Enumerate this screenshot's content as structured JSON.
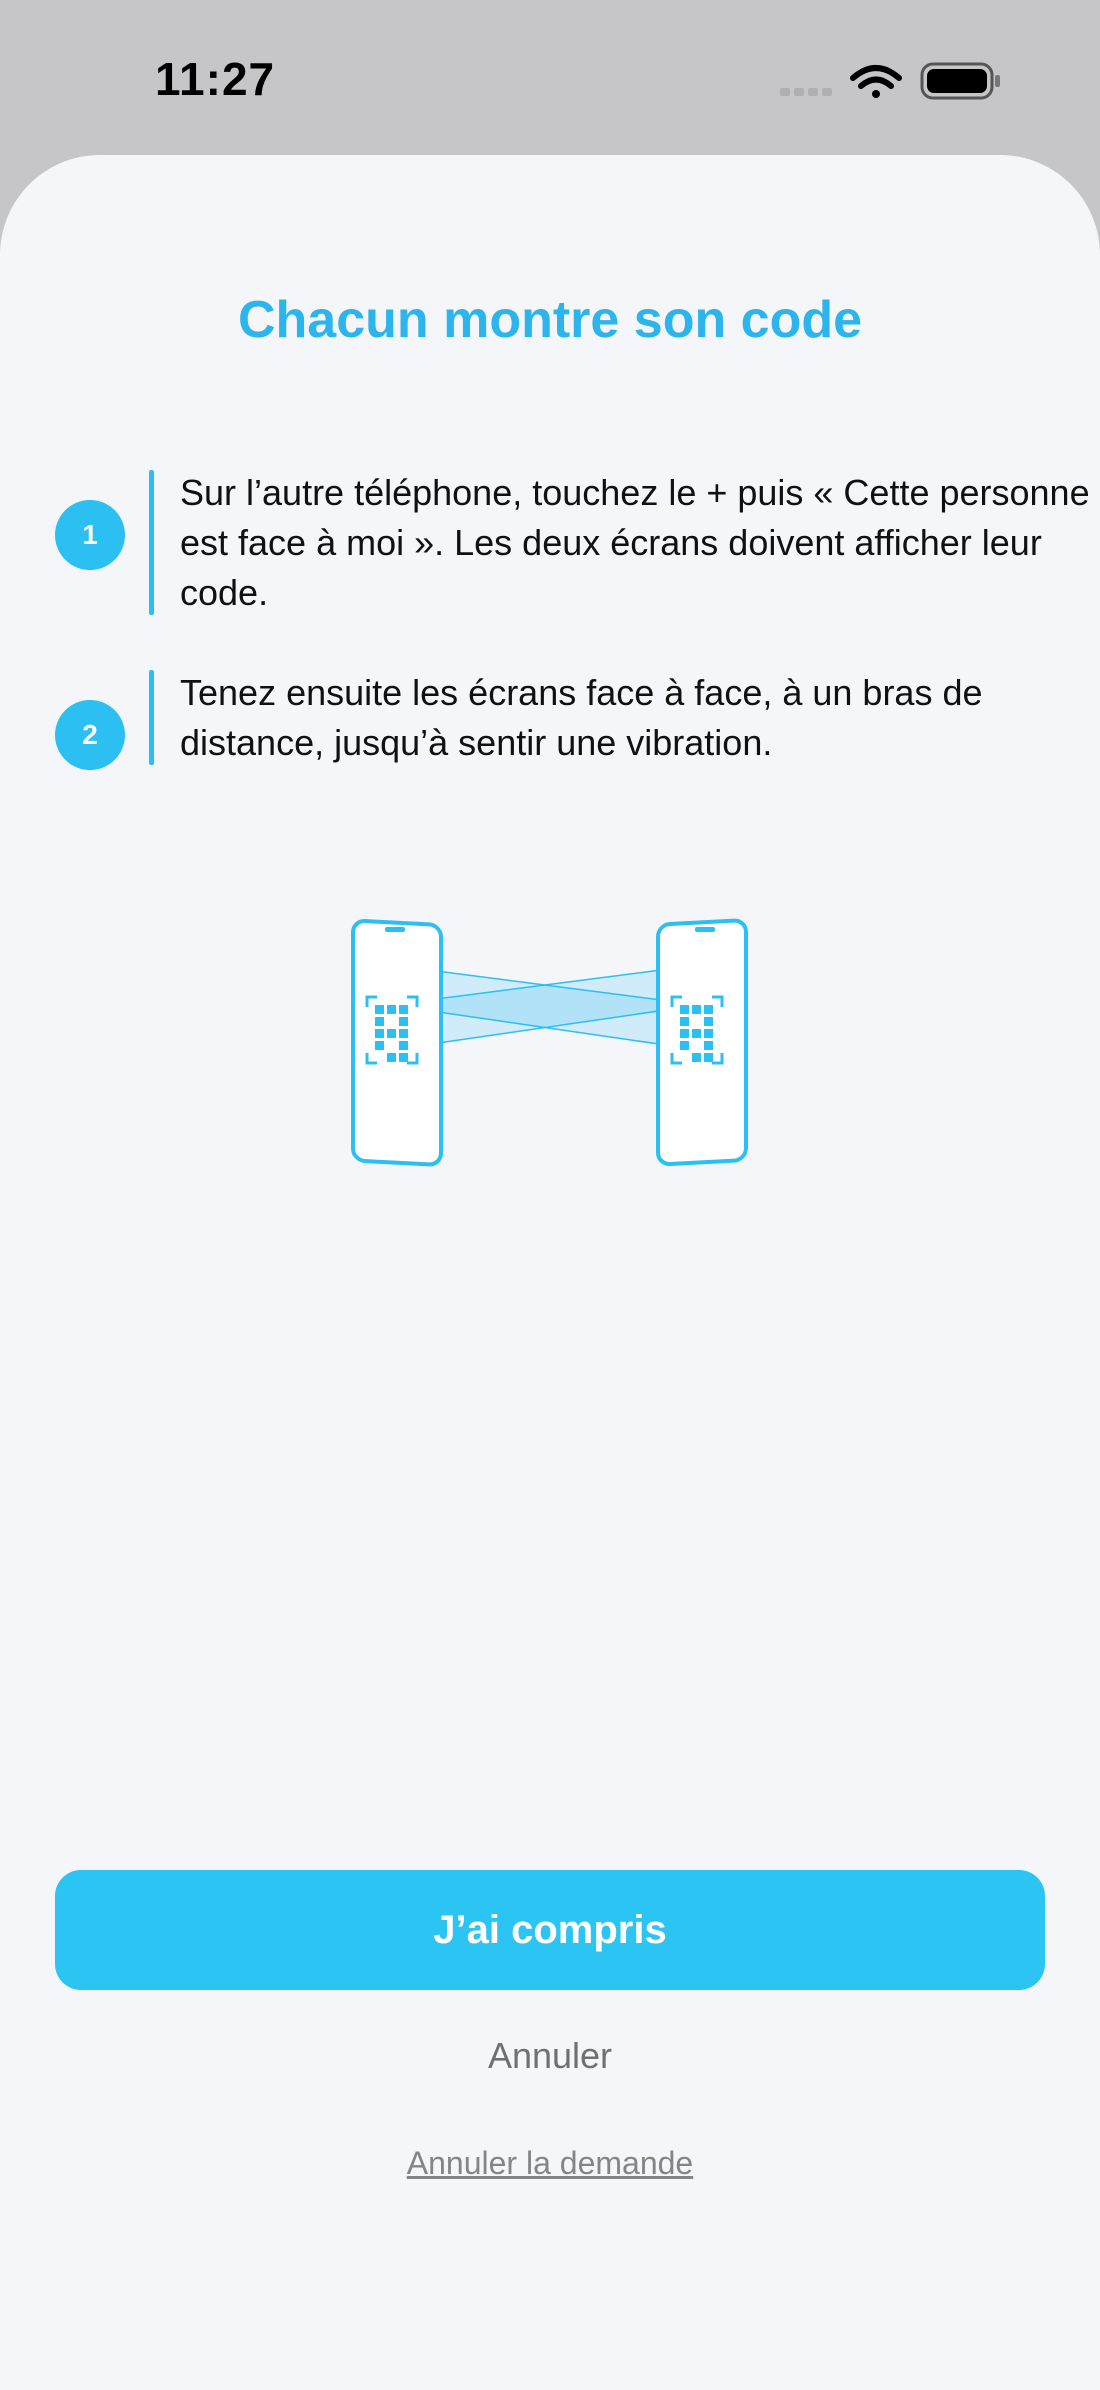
{
  "status_bar": {
    "time": "11:27",
    "icons": [
      "cellular-icon",
      "wifi-icon",
      "battery-icon"
    ]
  },
  "sheet": {
    "title": "Chacun montre son code",
    "steps": [
      {
        "number": "1",
        "text": "Sur l’autre téléphone, touchez le + puis « Cette personne est face à moi ». Les deux écrans doivent afficher leur code."
      },
      {
        "number": "2",
        "text": "Tenez ensuite les écrans face à face, à un bras de distance, jusqu’à sentir une vibration."
      }
    ],
    "illustration": {
      "icon": "phones-scanning-qr-illustration"
    },
    "primary_button": "J’ai compris",
    "cancel_button": "Annuler",
    "cancel_request_link": "Annuler la demande"
  },
  "colors": {
    "accent": "#2bbff2",
    "title": "#2bb5ec",
    "background": "#f4f6fa"
  }
}
